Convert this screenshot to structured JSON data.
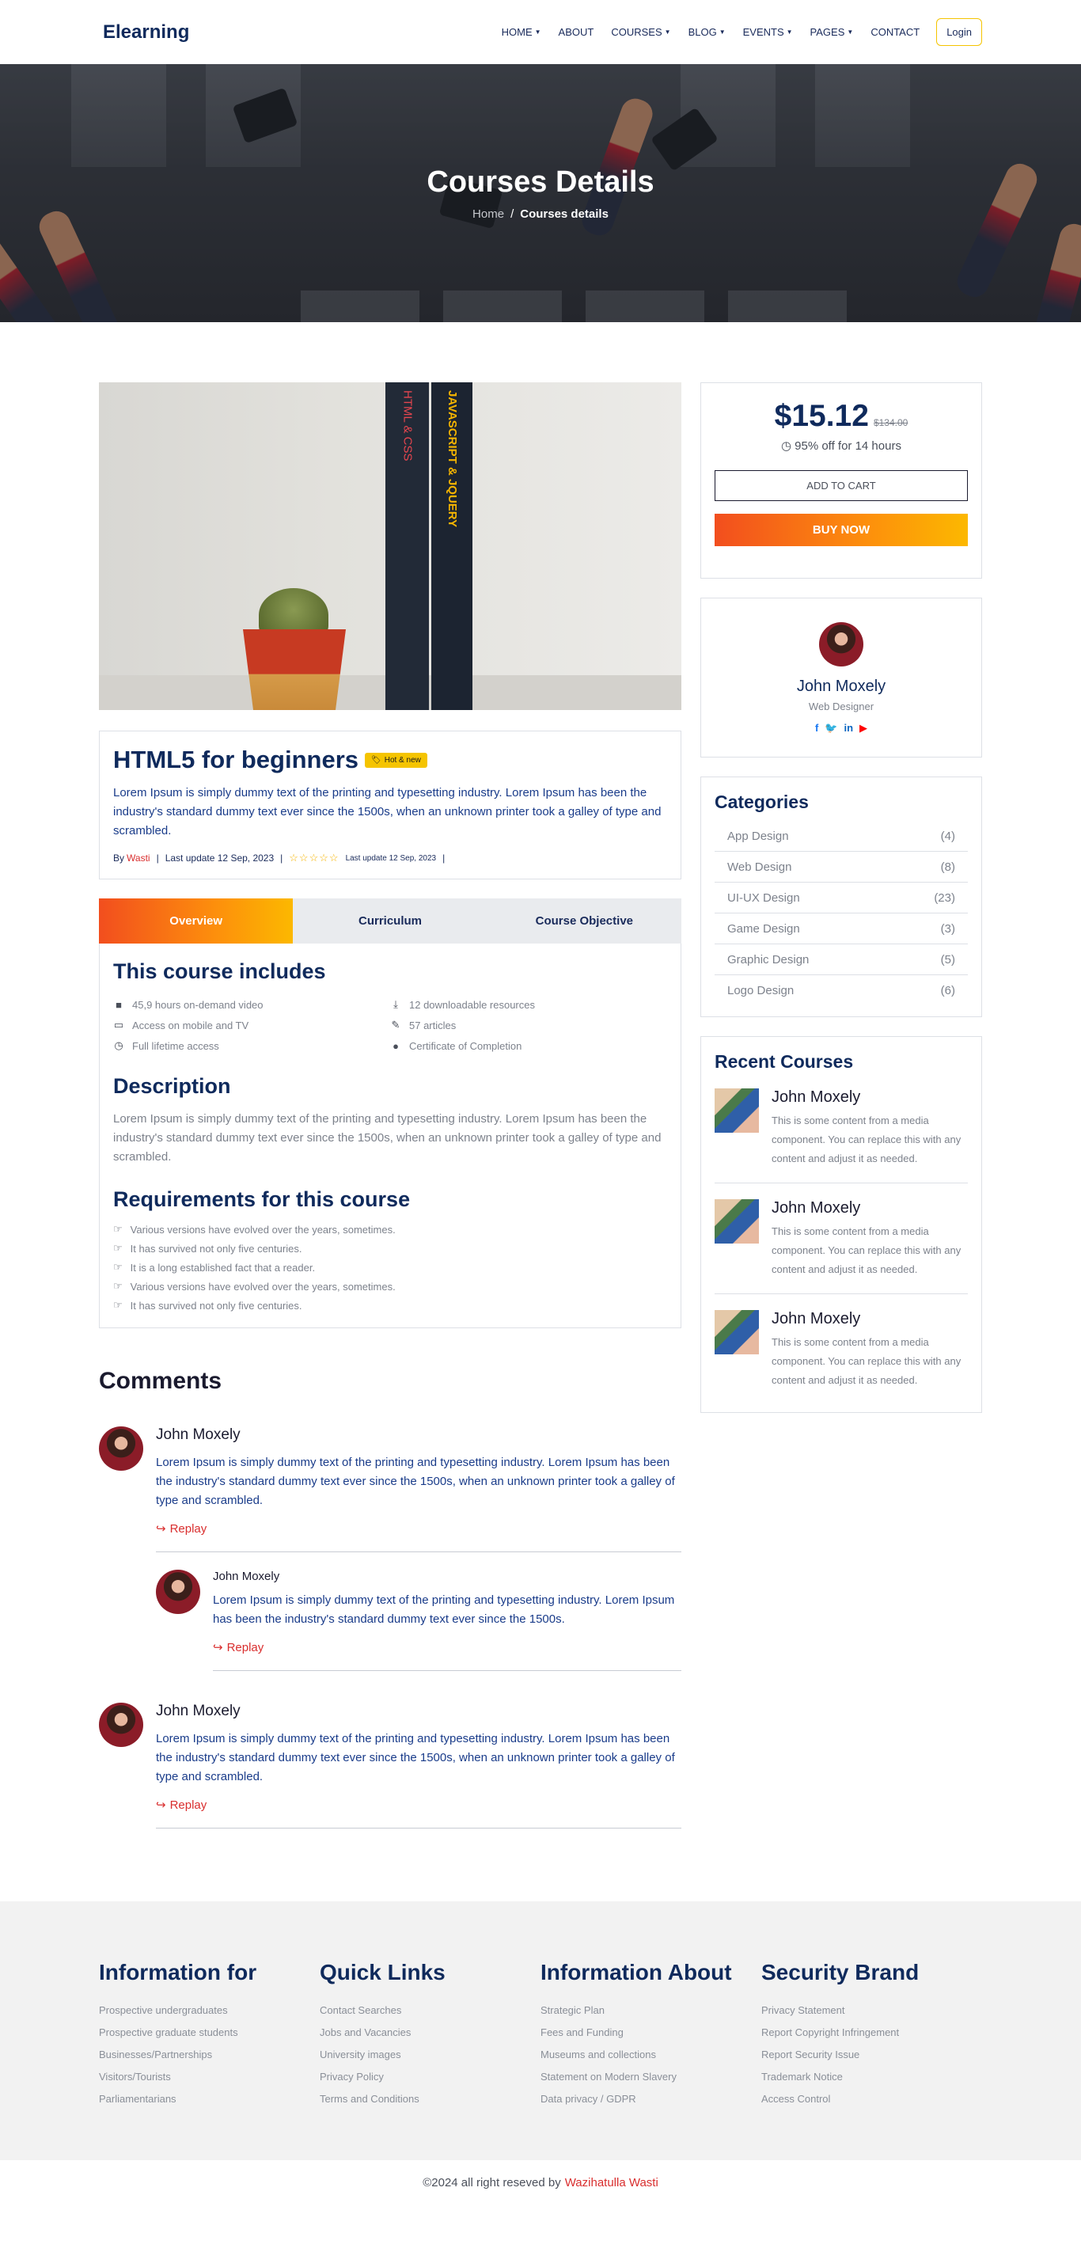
{
  "nav": {
    "brand": "Elearning",
    "items": [
      {
        "label": "HOME",
        "dropdown": true
      },
      {
        "label": "ABOUT",
        "dropdown": false
      },
      {
        "label": "COURSES",
        "dropdown": true
      },
      {
        "label": "BLOG",
        "dropdown": true
      },
      {
        "label": "EVENTS",
        "dropdown": true
      },
      {
        "label": "PAGES",
        "dropdown": true
      },
      {
        "label": "CONTACT",
        "dropdown": false
      }
    ],
    "login": "Login",
    "accent": "#f5c400"
  },
  "hero": {
    "title": "Courses Details",
    "breadcrumb_home": "Home",
    "breadcrumb_sep": "/",
    "breadcrumb_current": "Courses details"
  },
  "course": {
    "image_books": {
      "book1": "HTML & CSS",
      "book2": "JAVASCRIPT & JQUERY"
    },
    "title": "HTML5 for beginners",
    "badge": "Hot & new",
    "description": "Lorem Ipsum is simply dummy text of the printing and typesetting industry. Lorem Ipsum has been the industry's standard dummy text ever since the 1500s, when an unknown printer took a galley of type and scrambled.",
    "by_label": "By",
    "author": "Wasti",
    "last_update": "Last update 12 Sep, 2023",
    "last_update_small": "Last update 12 Sep, 2023"
  },
  "tabs": [
    {
      "label": "Overview",
      "active": true
    },
    {
      "label": "Curriculum",
      "active": false
    },
    {
      "label": "Course Objective",
      "active": false
    }
  ],
  "includes": {
    "title": "This course includes",
    "items": [
      {
        "icon": "video-icon",
        "text": "45,9 hours on-demand video"
      },
      {
        "icon": "download-icon",
        "text": "12 downloadable resources"
      },
      {
        "icon": "laptop-icon",
        "text": "Access on mobile and TV"
      },
      {
        "icon": "pencil-icon",
        "text": "57 articles"
      },
      {
        "icon": "clock-icon",
        "text": "Full lifetime access"
      },
      {
        "icon": "certificate-icon",
        "text": "Certificate of Completion"
      }
    ]
  },
  "description": {
    "title": "Description",
    "text": "Lorem Ipsum is simply dummy text of the printing and typesetting industry. Lorem Ipsum has been the industry's standard dummy text ever since the 1500s, when an unknown printer took a galley of type and scrambled."
  },
  "requirements": {
    "title": "Requirements for this course",
    "items": [
      "Various versions have evolved over the years, sometimes.",
      "It has survived not only five centuries.",
      "It is a long established fact that a reader.",
      "Various versions have evolved over the years, sometimes.",
      "It has survived not only five centuries."
    ]
  },
  "comments": {
    "title": "Comments",
    "reply_label": "Replay",
    "list": [
      {
        "name": "John Moxely",
        "text": "Lorem Ipsum is simply dummy text of the printing and typesetting industry. Lorem Ipsum has been the industry's standard dummy text ever since the 1500s, when an unknown printer took a galley of type and scrambled."
      },
      {
        "name": "John Moxely",
        "text": "Lorem Ipsum is simply dummy text of the printing and typesetting industry. Lorem Ipsum has been the industry's standard dummy text ever since the 1500s."
      },
      {
        "name": "John Moxely",
        "text": "Lorem Ipsum is simply dummy text of the printing and typesetting industry. Lorem Ipsum has been the industry's standard dummy text ever since the 1500s, when an unknown printer took a galley of type and scrambled."
      }
    ]
  },
  "pricing": {
    "price": "$15.12",
    "old_price": "$134.00",
    "discount": "95% off for 14 hours",
    "add_to_cart": "ADD TO CART",
    "buy_now": "BUY NOW"
  },
  "instructor": {
    "name": "John Moxely",
    "role": "Web Designer",
    "social": [
      "facebook-icon",
      "twitter-icon",
      "linkedin-icon",
      "youtube-icon"
    ]
  },
  "categories": {
    "title": "Categories",
    "items": [
      {
        "name": "App Design",
        "count": "(4)"
      },
      {
        "name": "Web Design",
        "count": "(8)"
      },
      {
        "name": "UI-UX Design",
        "count": "(23)"
      },
      {
        "name": "Game Design",
        "count": "(3)"
      },
      {
        "name": "Graphic Design",
        "count": "(5)"
      },
      {
        "name": "Logo Design",
        "count": "(6)"
      }
    ]
  },
  "recent": {
    "title": "Recent Courses",
    "items": [
      {
        "name": "John Moxely",
        "text": "This is some content from a media component. You can replace this with any content and adjust it as needed."
      },
      {
        "name": "John Moxely",
        "text": "This is some content from a media component. You can replace this with any content and adjust it as needed."
      },
      {
        "name": "John Moxely",
        "text": "This is some content from a media component. You can replace this with any content and adjust it as needed."
      }
    ]
  },
  "footer": {
    "columns": [
      {
        "title": "Information for",
        "links": [
          "Prospective undergraduates",
          "Prospective graduate students",
          "Businesses/Partnerships",
          "Visitors/Tourists",
          "Parliamentarians"
        ]
      },
      {
        "title": "Quick Links",
        "links": [
          "Contact Searches",
          "Jobs and Vacancies",
          "University images",
          "Privacy Policy",
          "Terms and Conditions"
        ]
      },
      {
        "title": "Information About",
        "links": [
          "Strategic Plan",
          "Fees and Funding",
          "Museums and collections",
          "Statement on Modern Slavery",
          "Data privacy / GDPR"
        ]
      },
      {
        "title": "Security Brand",
        "links": [
          "Privacy Statement",
          "Report Copyright Infringement",
          "Report Security Issue",
          "Trademark Notice",
          "Access Control"
        ]
      }
    ],
    "copyright": "©2024 all right reseved by",
    "copyright_author": "Wazihatulla Wasti"
  }
}
